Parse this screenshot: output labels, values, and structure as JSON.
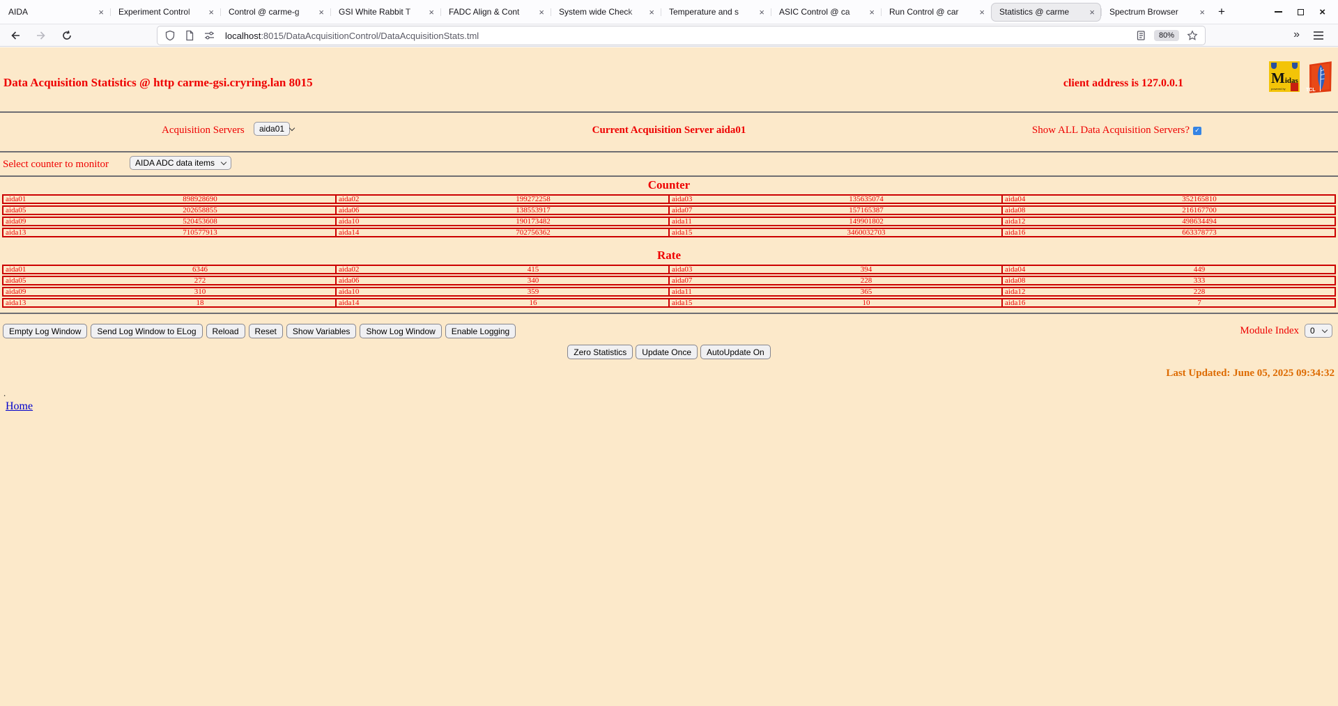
{
  "window": {
    "title_tabs": [
      "AIDA",
      "Experiment Control",
      "Control @ carme-g",
      "GSI White Rabbit T",
      "FADC Align & Cont",
      "System wide Check",
      "Temperature and s",
      "ASIC Control @ ca",
      "Run Control @ car",
      "Statistics @ carme",
      "Spectrum Browser"
    ],
    "active_tab_index": 9,
    "icons": {
      "tab_close": "×",
      "new_tab": "+",
      "overflow": "»"
    },
    "nav": {
      "url_host": "localhost",
      "url_path": ":8015/DataAcquisitionControl/DataAcquisitionStats.tml",
      "zoom_badge": "80%"
    }
  },
  "page": {
    "title": "Data Acquisition Statistics @ http carme-gsi.cryring.lan 8015",
    "client_address": "client address is 127.0.0.1",
    "logos": {
      "midas_initial": "M",
      "midas_rest": "idas",
      "midas_powered": "powered by",
      "tcl": "TCL"
    },
    "server_row": {
      "label": "Acquisition Servers",
      "selected": "aida01",
      "current": "Current Acquisition Server aida01",
      "show_all_label": "Show ALL Data Acquisition Servers?",
      "show_all_checked": true
    },
    "counter_select": {
      "label": "Select counter to monitor",
      "selected": "AIDA ADC data items"
    },
    "counter": {
      "heading": "Counter",
      "rows": [
        [
          [
            "aida01",
            "898928690"
          ],
          [
            "aida02",
            "199272258"
          ],
          [
            "aida03",
            "135635074"
          ],
          [
            "aida04",
            "352165810"
          ]
        ],
        [
          [
            "aida05",
            "202658855"
          ],
          [
            "aida06",
            "138553917"
          ],
          [
            "aida07",
            "157165387"
          ],
          [
            "aida08",
            "216167700"
          ]
        ],
        [
          [
            "aida09",
            "520453608"
          ],
          [
            "aida10",
            "190173482"
          ],
          [
            "aida11",
            "149901802"
          ],
          [
            "aida12",
            "498634494"
          ]
        ],
        [
          [
            "aida13",
            "710577913"
          ],
          [
            "aida14",
            "702756362"
          ],
          [
            "aida15",
            "3460032703"
          ],
          [
            "aida16",
            "663378773"
          ]
        ]
      ]
    },
    "rate": {
      "heading": "Rate",
      "rows": [
        [
          [
            "aida01",
            "6346"
          ],
          [
            "aida02",
            "415"
          ],
          [
            "aida03",
            "394"
          ],
          [
            "aida04",
            "449"
          ]
        ],
        [
          [
            "aida05",
            "272"
          ],
          [
            "aida06",
            "340"
          ],
          [
            "aida07",
            "228"
          ],
          [
            "aida08",
            "333"
          ]
        ],
        [
          [
            "aida09",
            "310"
          ],
          [
            "aida10",
            "359"
          ],
          [
            "aida11",
            "365"
          ],
          [
            "aida12",
            "228"
          ]
        ],
        [
          [
            "aida13",
            "18"
          ],
          [
            "aida14",
            "16"
          ],
          [
            "aida15",
            "10"
          ],
          [
            "aida16",
            "7"
          ]
        ]
      ]
    },
    "log_buttons": [
      "Empty Log Window",
      "Send Log Window to ELog",
      "Reload",
      "Reset",
      "Show Variables",
      "Show Log Window",
      "Enable Logging"
    ],
    "module_index": {
      "label": "Module Index",
      "selected": "0"
    },
    "action_buttons": [
      "Zero Statistics",
      "Update Once",
      "AutoUpdate On"
    ],
    "last_updated": "Last Updated: June 05, 2025 09:34:32",
    "dot": ".",
    "home_link": "Home"
  },
  "colors": {
    "page_bg": "#FCE9CA",
    "accent_red": "#EE0000",
    "table_border": "#CC0000",
    "last_updated_orange": "#DD6A00",
    "link_blue": "#0000CC",
    "checkbox_blue": "#3584E4"
  }
}
